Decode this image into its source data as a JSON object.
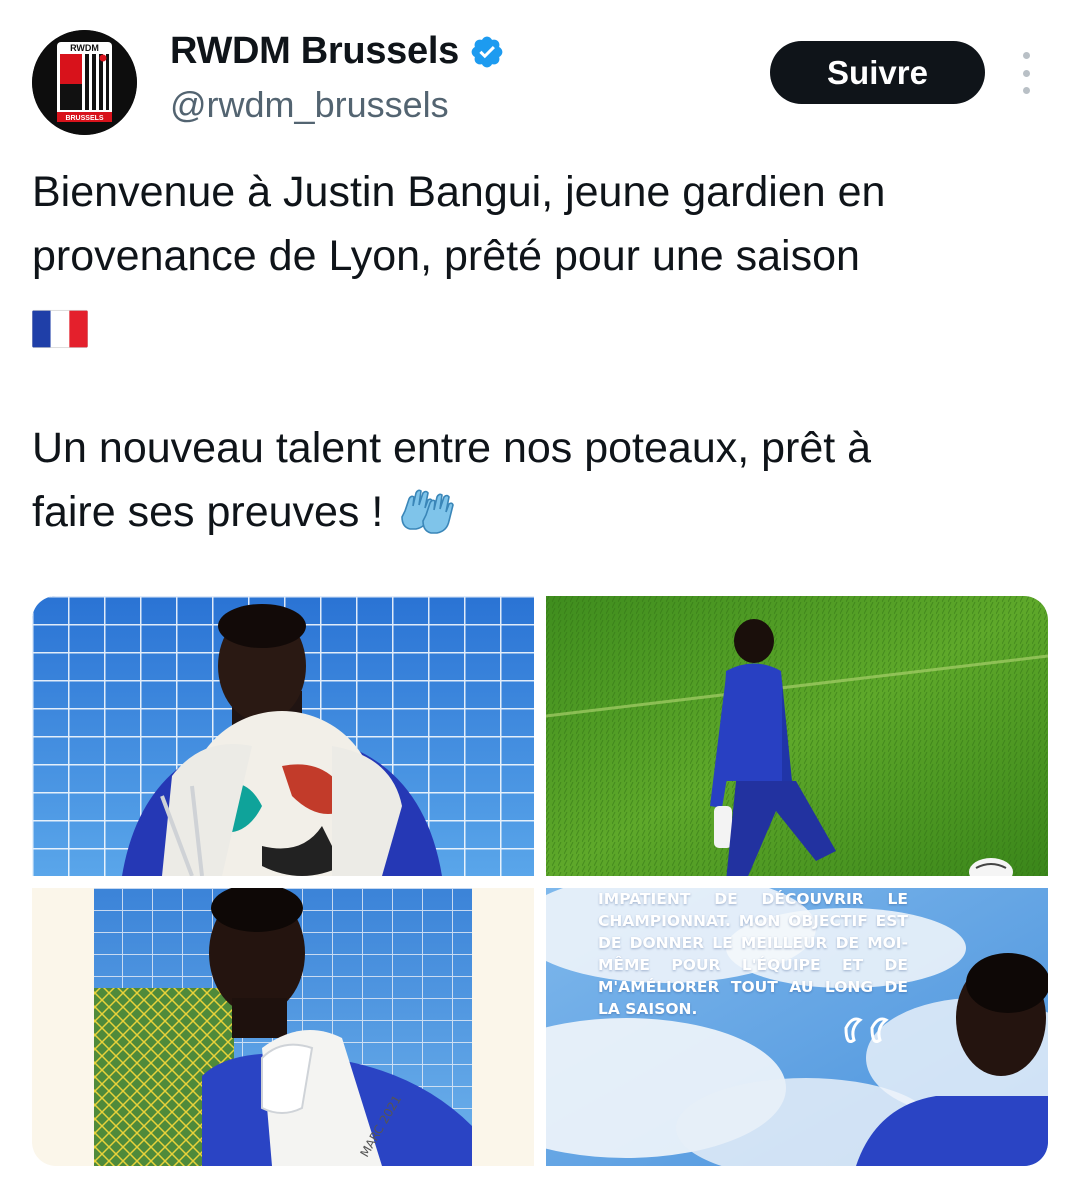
{
  "account": {
    "display_name": "RWDM Brussels",
    "handle": "@rwdm_brussels",
    "verified": true,
    "avatar_logo_text": "RWDM",
    "avatar_logo_subtext": "BRUSSELS"
  },
  "actions": {
    "follow_label": "Suivre",
    "more_icon": "vertical-ellipsis-icon"
  },
  "tweet": {
    "line1": "Bienvenue à Justin Bangui, jeune gardien en",
    "line2": "provenance de Lyon, prêté pour une saison",
    "flag_emoji": "france-flag-icon",
    "line4": "Un nouveau talent entre nos poteaux, prêt à",
    "line5": "faire ses preuves !",
    "gloves_emoji": "goalkeeper-gloves-icon"
  },
  "media": {
    "count": 4,
    "quote_card_text": "Impatient de découvrir le championnat. Mon objectif est de donner le meilleur de moi-même pour l'équipe et de m'améliorer tout au long de la saison.",
    "colors": {
      "sky_blue": "#2f7fd6",
      "pitch_green": "#4f9a22",
      "kit_blue": "#2740b8"
    }
  }
}
